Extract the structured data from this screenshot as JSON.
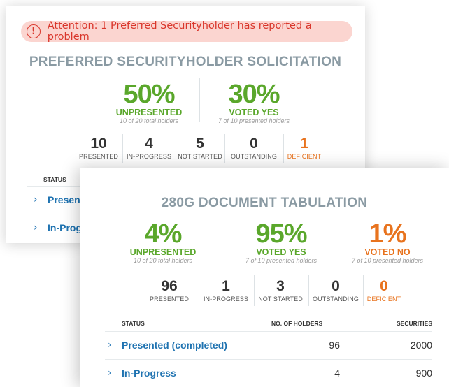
{
  "card1": {
    "alert": "Attention: 1 Preferred Securityholder has reported a problem",
    "alert_icon": "!",
    "title": "PREFERRED SECURITYHOLDER SOLICITATION",
    "metrics": [
      {
        "pct": "50%",
        "label": "UNPRESENTED",
        "sub": "10 of 20 total holders"
      },
      {
        "pct": "30%",
        "label": "VOTED YES",
        "sub": "7 of 10 presented holders"
      }
    ],
    "counts": [
      {
        "num": "10",
        "label": "PRESENTED"
      },
      {
        "num": "4",
        "label": "IN-PROGRESS"
      },
      {
        "num": "5",
        "label": "NOT STARTED"
      },
      {
        "num": "0",
        "label": "OUTSTANDING"
      },
      {
        "num": "1",
        "label": "DEFICIENT"
      }
    ],
    "table": {
      "status_header": "STATUS",
      "rows": [
        "Presented (completed)",
        "In-Progress"
      ]
    }
  },
  "card2": {
    "title": "280G DOCUMENT TABULATION",
    "metrics": [
      {
        "pct": "4%",
        "label": "UNPRESENTED",
        "sub": "10 of 20 total holders"
      },
      {
        "pct": "95%",
        "label": "VOTED YES",
        "sub": "7 of 10 presented holders"
      },
      {
        "pct": "1%",
        "label": "VOTED NO",
        "sub": "7 of 10 presented holders"
      }
    ],
    "counts": [
      {
        "num": "96",
        "label": "PRESENTED"
      },
      {
        "num": "1",
        "label": "IN-PROGRESS"
      },
      {
        "num": "3",
        "label": "NOT STARTED"
      },
      {
        "num": "0",
        "label": "OUTSTANDING"
      },
      {
        "num": "0",
        "label": "DEFICIENT"
      }
    ],
    "table": {
      "headers": {
        "status": "STATUS",
        "holders": "NO. OF HOLDERS",
        "securities": "SECURITIES"
      },
      "rows": [
        {
          "label": "Presented (completed)",
          "holders": "96",
          "securities": "2000"
        },
        {
          "label": "In-Progress",
          "holders": "4",
          "securities": "900"
        }
      ]
    }
  },
  "icons": {
    "chevron": "chevron-right-icon",
    "alert": "alert-circle-icon"
  },
  "colors": {
    "green": "#5aa72b",
    "orange": "#e8731e",
    "link": "#1f73b1",
    "alert": "#d9362b",
    "title": "#8a9aa3"
  }
}
